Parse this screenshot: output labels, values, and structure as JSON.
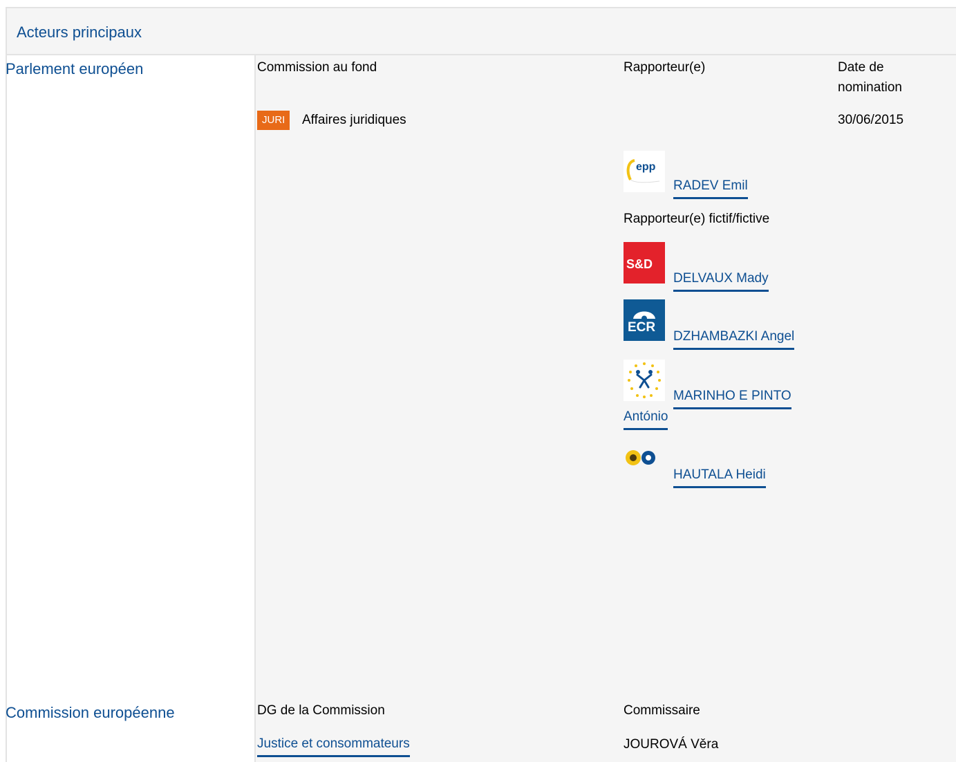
{
  "section": {
    "title": "Acteurs principaux"
  },
  "parliament": {
    "label": "Parlement européen",
    "headers": {
      "committee": "Commission au fond",
      "rapporteur": "Rapporteur(e)",
      "date_line1": "Date de",
      "date_line2": "nomination"
    },
    "committee": {
      "badge": "JURI",
      "name": "Affaires juridiques",
      "date": "30/06/2015"
    },
    "rapporteur": {
      "name": "RADEV Emil",
      "group_logo": "epp-logo"
    },
    "shadow_label": "Rapporteur(e) fictif/fictive",
    "shadows": [
      {
        "name": "DELVAUX Mady",
        "group_logo": "sd-logo",
        "logo_text": "S&D"
      },
      {
        "name": "DZHAMBAZKI Angel",
        "group_logo": "ecr-logo",
        "logo_text": "ECR"
      },
      {
        "name_line1": "MARINHO E PINTO",
        "name_line2": "António",
        "group_logo": "alde-logo"
      },
      {
        "name": "HAUTALA Heidi",
        "group_logo": "greens-logo"
      }
    ],
    "epp_logo_text": "epp"
  },
  "commission": {
    "label": "Commission européenne",
    "headers": {
      "dg": "DG de la Commission",
      "commissioner": "Commissaire"
    },
    "dg": "Justice et consommateurs",
    "commissioner": "JOUROVÁ Věra"
  },
  "colors": {
    "link": "#0e4f92",
    "badge": "#e86a18",
    "panel": "#f5f5f5",
    "border": "#e3e3e3",
    "sd": "#e3222b",
    "ecr": "#0f5a95"
  }
}
